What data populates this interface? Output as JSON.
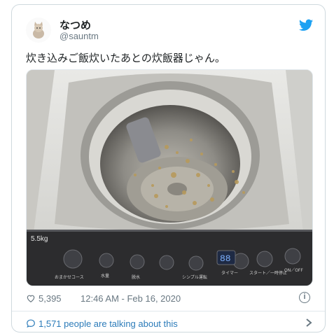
{
  "tweet": {
    "display_name": "なつめ",
    "handle": "@sauntm",
    "text": "炊き込みご飯炊いたあとの炊飯器じゃん。",
    "likes": "5,395",
    "timestamp": "12:46 AM - Feb 16, 2020",
    "conversation": "1,571 people are talking about this"
  },
  "icons": {
    "avatar": "cat-avatar",
    "brand": "twitter-bird-icon",
    "like": "heart-icon",
    "info": "info-icon",
    "reply": "speech-bubble-icon",
    "chevron": "chevron-right-icon"
  },
  "image_labels": {
    "capacity": "5.5kg",
    "start_label": "スタート／一時停止",
    "onoff_label": "ON／OFF",
    "course_label": "おまかせコース",
    "water_label": "水量",
    "wash_label": "洗い",
    "rinse_label": "すすぎ",
    "dry_label": "脱水",
    "soak_label": "シンプル運転",
    "timer_label": "タイマー",
    "display_value": "88"
  },
  "colors": {
    "accent": "#1da1f2",
    "link": "#2b7bb9",
    "muted": "#697882",
    "border": "#cfd9de"
  }
}
